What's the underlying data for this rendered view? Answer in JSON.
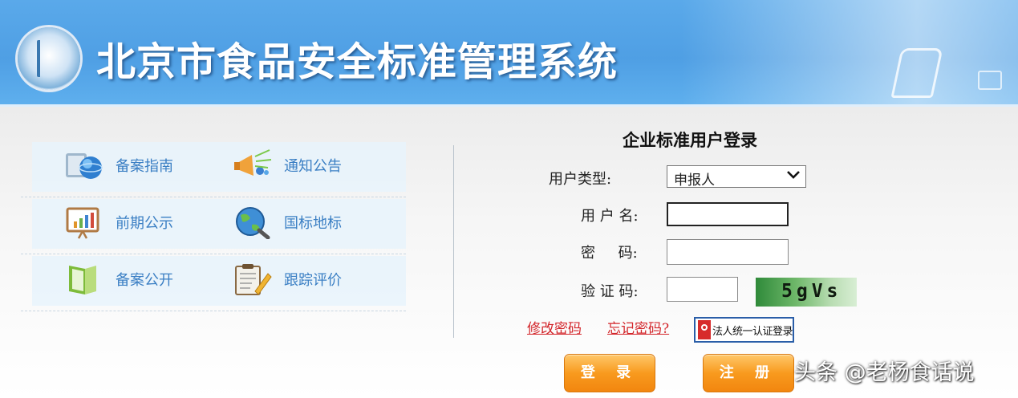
{
  "header": {
    "title": "北京市食品安全标准管理系统"
  },
  "menu": {
    "items": [
      {
        "label": "备案指南",
        "icon": "globe-document-icon"
      },
      {
        "label": "通知公告",
        "icon": "megaphone-icon"
      },
      {
        "label": "前期公示",
        "icon": "chart-board-icon"
      },
      {
        "label": "国标地标",
        "icon": "globe-magnifier-icon"
      },
      {
        "label": "备案公开",
        "icon": "open-folder-icon"
      },
      {
        "label": "跟踪评价",
        "icon": "clipboard-pen-icon"
      }
    ]
  },
  "login": {
    "title": "企业标准用户登录",
    "user_type_label": "用户类型:",
    "user_type_value": "申报人",
    "username_label": "用 户 名:",
    "username_value": "",
    "password_label": "密     码:",
    "password_value": "",
    "captcha_label": "验 证 码:",
    "captcha_value": "",
    "captcha_text": "5gVs",
    "change_password": "修改密码",
    "forgot_password": "忘记密码?",
    "legal_login": "法人统一认证登录",
    "login_button": "登 录",
    "register_button": "注 册"
  },
  "watermark": "头条 @老杨食话说",
  "colors": {
    "header_blue": "#4f9fe4",
    "menu_text": "#3b7fc4",
    "link_red": "#d3262b",
    "button_orange": "#f89a1e"
  }
}
